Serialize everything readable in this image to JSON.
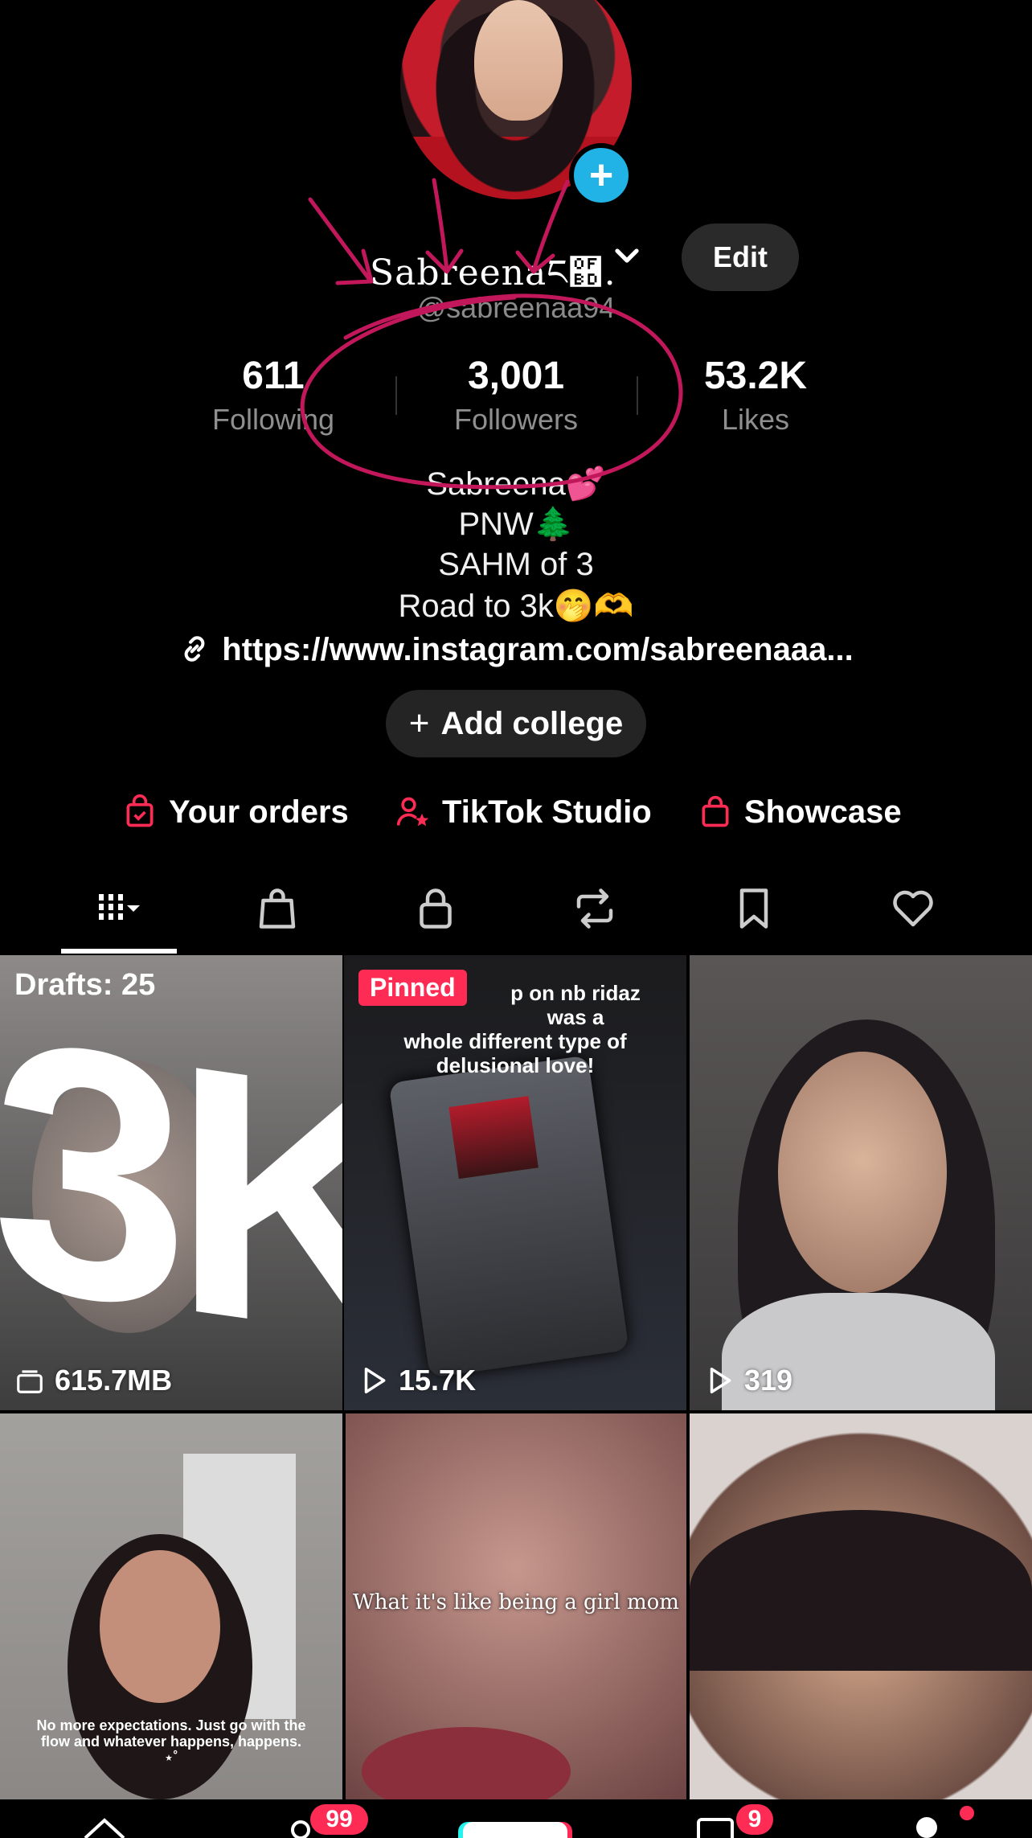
{
  "profile": {
    "display_name": "Sabreenaང྽.",
    "username": "@sabreenaa94",
    "edit_label": "Edit"
  },
  "stats": [
    {
      "value": "611",
      "label": "Following"
    },
    {
      "value": "3,001",
      "label": "Followers"
    },
    {
      "value": "53.2K",
      "label": "Likes"
    }
  ],
  "bio": {
    "lines": [
      "Sabreena💕",
      "PNW🌲",
      "SAHM of 3",
      "Road to 3k🤭🫶"
    ],
    "link": "https://www.instagram.com/sabreenaaa..."
  },
  "add_college_label": "Add college",
  "shortcuts": [
    {
      "label": "Your orders",
      "icon": "orders-bag-icon"
    },
    {
      "label": "TikTok Studio",
      "icon": "studio-person-star-icon"
    },
    {
      "label": "Showcase",
      "icon": "shopping-bag-icon"
    }
  ],
  "tabs": [
    {
      "icon": "videos-grid-icon",
      "active": true
    },
    {
      "icon": "shop-bag-icon"
    },
    {
      "icon": "lock-icon"
    },
    {
      "icon": "repost-icon"
    },
    {
      "icon": "bookmark-icon"
    },
    {
      "icon": "heart-icon"
    }
  ],
  "grid": {
    "tile1": {
      "drafts": "Drafts: 25",
      "overlay_text": "3K",
      "meta": "615.7MB"
    },
    "tile2": {
      "pinned": "Pinned",
      "caption_a": "p on nb ridaz was a",
      "caption_b": "whole different type of delusional love!",
      "meta": "15.7K"
    },
    "tile3": {
      "meta": "319"
    },
    "tile4": {
      "caption": "No more expectations. Just go with the flow and whatever happens, happens. ⋆˚"
    },
    "tile5": {
      "caption": "What it's like being a girl mom"
    }
  },
  "nav_badges": {
    "friends": "99",
    "inbox": "9"
  },
  "colors": {
    "accent": "#fe2c55",
    "badge_blue": "#22b3e6",
    "annotation": "#c2185b"
  }
}
